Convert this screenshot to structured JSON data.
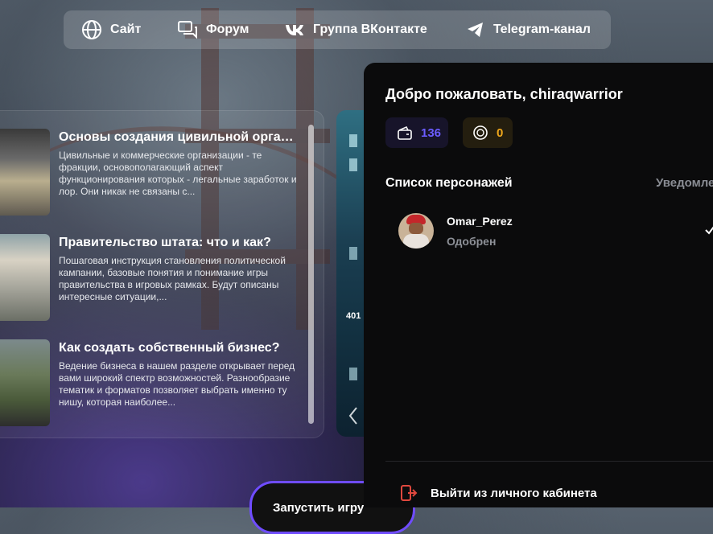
{
  "nav": {
    "items": [
      {
        "label": "Сайт",
        "icon": "globe-icon"
      },
      {
        "label": "Форум",
        "icon": "chat-icon"
      },
      {
        "label": "Группа ВКонтакте",
        "icon": "vk-icon"
      },
      {
        "label": "Telegram-канал",
        "icon": "telegram-icon"
      }
    ]
  },
  "news": [
    {
      "title": "Основы создания цивильной организации",
      "desc": "Цивильные и коммерческие организации - те фракции, основополагающий аспект функционирования которых - легальные заработок и лор. Они никак не связаны с..."
    },
    {
      "title": "Правительство штата: что и как?",
      "desc": "Пошаговая инструкция становления политической кампании, базовые понятия и понимание игры правительства в игровых рамках. Будут описаны интересные ситуации,..."
    },
    {
      "title": "Как создать собственный бизнес?",
      "desc": "Ведение бизнеса в нашем разделе открывает перед вами широкий спектр возможностей. Разнообразие тематик и форматов позволяет выбрать именно ту нишу, которая наиболее..."
    }
  ],
  "banner": {
    "number": "401"
  },
  "launch": {
    "label": "Запустить игру"
  },
  "panel": {
    "welcome": "Добро пожаловать, chiraqwarrior",
    "balance": {
      "value": "136",
      "color": "#6b5cff",
      "icon": "wallet-icon"
    },
    "coins": {
      "value": "0",
      "color": "#f0a81c",
      "icon": "coin-icon"
    },
    "characters_title": "Список персонажей",
    "notifications_label": "Уведомления",
    "character": {
      "name": "Omar_Perez",
      "status": "Одобрен"
    },
    "logout_label": "Выйти из личного кабинета",
    "accent_logout": "#e0483e"
  }
}
